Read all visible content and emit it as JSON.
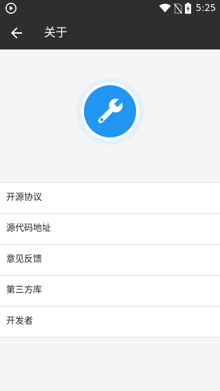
{
  "status_bar": {
    "time": "5:25",
    "icons": [
      "app-notification-icon",
      "wifi-icon",
      "no-sim-icon",
      "battery-charging-icon"
    ]
  },
  "app_bar": {
    "back_icon": "arrow-back-icon",
    "title": "关于"
  },
  "logo": {
    "icon": "wrench-icon",
    "colors": {
      "accent": "#2196f3",
      "halo": "#e3f1fc"
    }
  },
  "menu": {
    "items": [
      {
        "label": "开源协议"
      },
      {
        "label": "源代码地址"
      },
      {
        "label": "意见反馈"
      },
      {
        "label": "第三方库"
      },
      {
        "label": "开发者"
      }
    ]
  },
  "colors": {
    "toolbar": "#2e2e2e",
    "background": "#f5f5f5",
    "list_background": "#ffffff",
    "divider": "#dcdcdc"
  }
}
